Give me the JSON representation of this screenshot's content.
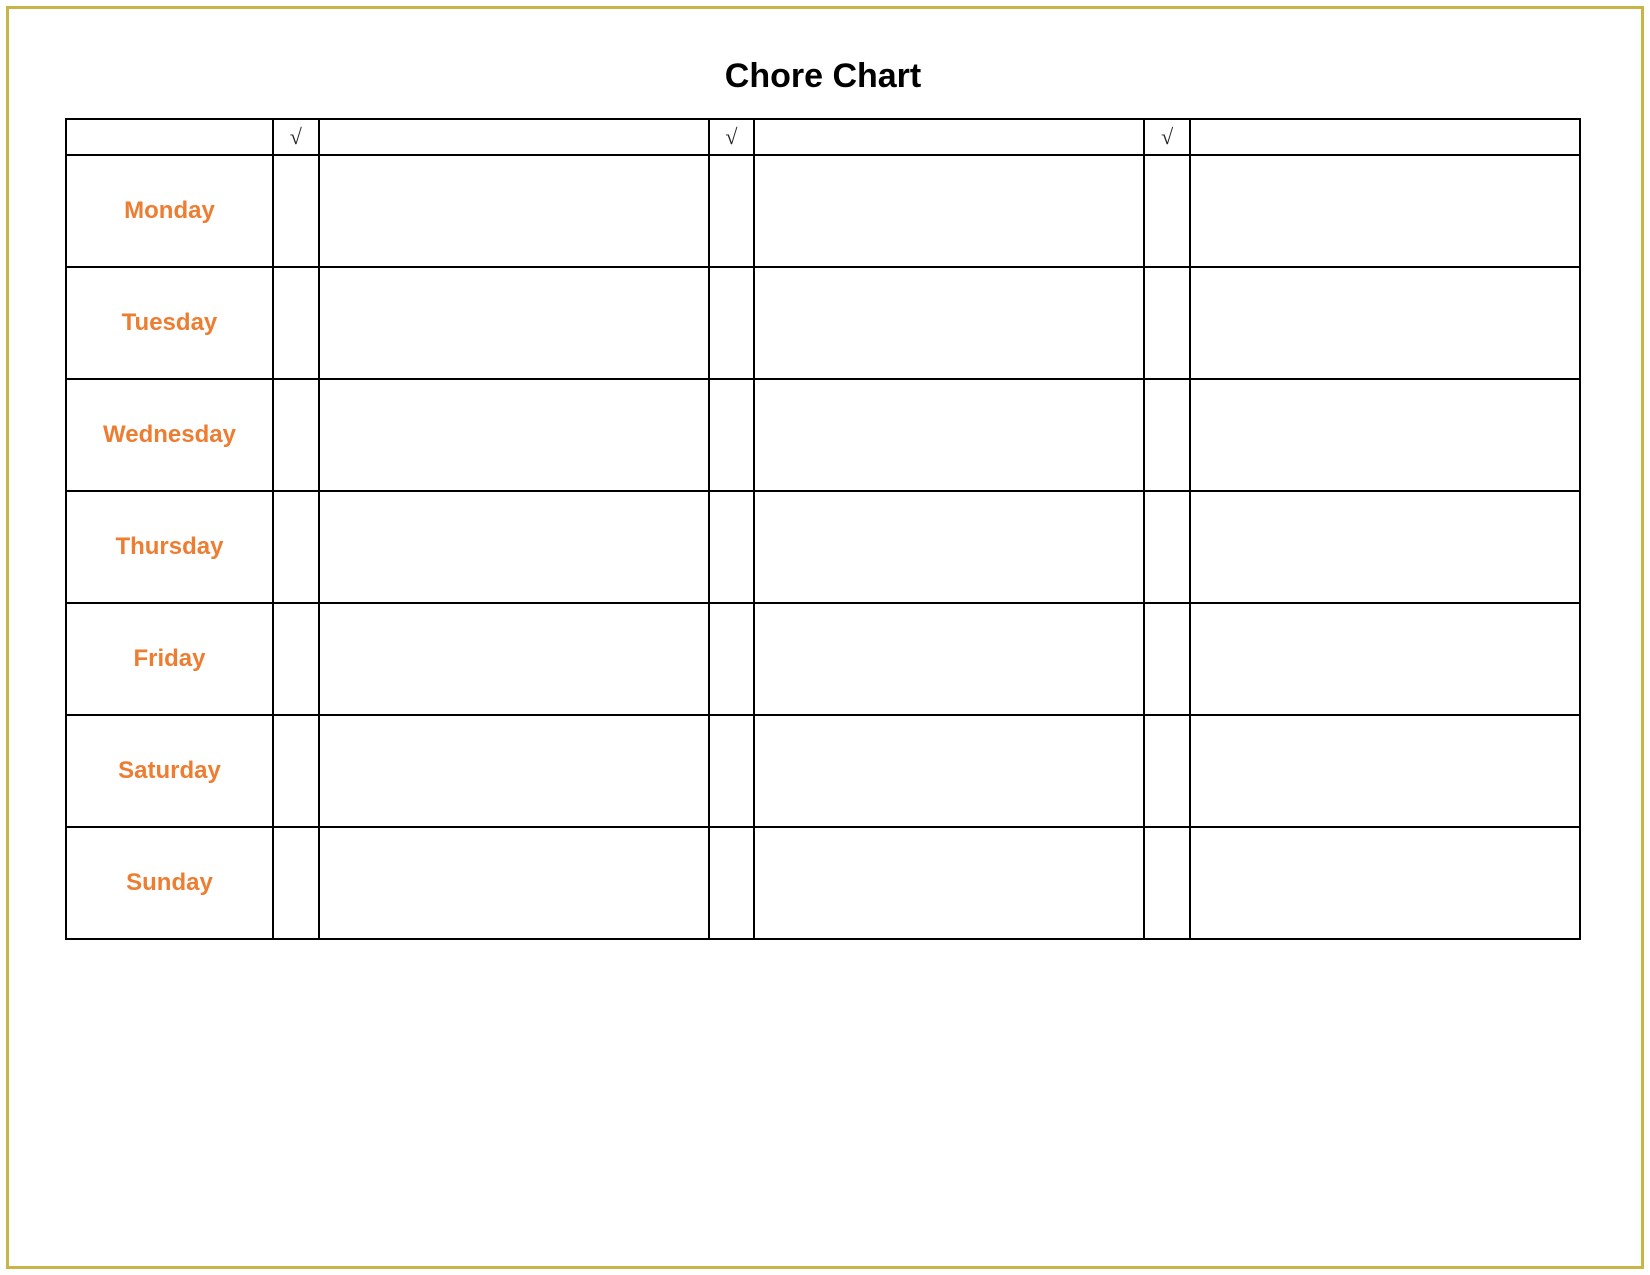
{
  "title": "Chore Chart",
  "checkmark": "√",
  "colors": {
    "frame_border": "#c9b545",
    "day_text": "#ed7d31",
    "table_border": "#000000"
  },
  "header": {
    "blank": "",
    "check1": "√",
    "task1": "",
    "check2": "√",
    "task2": "",
    "check3": "√",
    "task3": ""
  },
  "days": [
    {
      "label": "Monday"
    },
    {
      "label": "Tuesday"
    },
    {
      "label": "Wednesday"
    },
    {
      "label": "Thursday"
    },
    {
      "label": "Friday"
    },
    {
      "label": "Saturday"
    },
    {
      "label": "Sunday"
    }
  ]
}
